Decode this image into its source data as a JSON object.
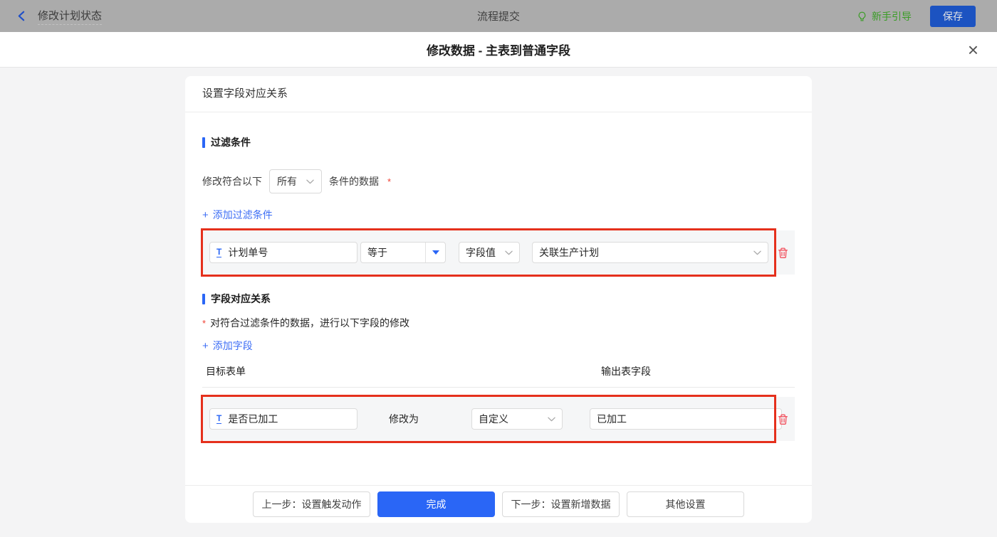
{
  "topbar": {
    "back_title": "修改计划状态",
    "center_title": "流程提交",
    "guide_label": "新手引导",
    "save_label": "保存"
  },
  "modal": {
    "title": "修改数据 - 主表到普通字段",
    "close_glyph": "×"
  },
  "panel": {
    "header": "设置字段对应关系",
    "filter": {
      "title": "过滤条件",
      "match_prefix": "修改符合以下",
      "match_value": "所有",
      "match_suffix": "条件的数据",
      "required": "*",
      "plus": "+",
      "add_label": "添加过滤条件",
      "row": {
        "field_icon": "T",
        "field": "计划单号",
        "operator": "等于",
        "value_type": "字段值",
        "value": "关联生产计划"
      }
    },
    "mapping": {
      "title": "字段对应关系",
      "required": "*",
      "description": "对符合过滤条件的数据，进行以下字段的修改",
      "plus": "+",
      "add_label": "添加字段",
      "columns": {
        "target": "目标表单",
        "output": "输出表字段"
      },
      "row": {
        "field_icon": "T",
        "field": "是否已加工",
        "action": "修改为",
        "value_type": "自定义",
        "value": "已加工"
      }
    },
    "footer": {
      "prev": "上一步：设置触发动作",
      "finish": "完成",
      "next": "下一步：设置新增数据",
      "other": "其他设置"
    }
  },
  "colors": {
    "accent_blue": "#2a66f6",
    "highlight_red": "#e5301c",
    "danger_red": "#f24957",
    "guide_green": "#3a9c26",
    "topbar_save_blue": "#1c53c1"
  }
}
